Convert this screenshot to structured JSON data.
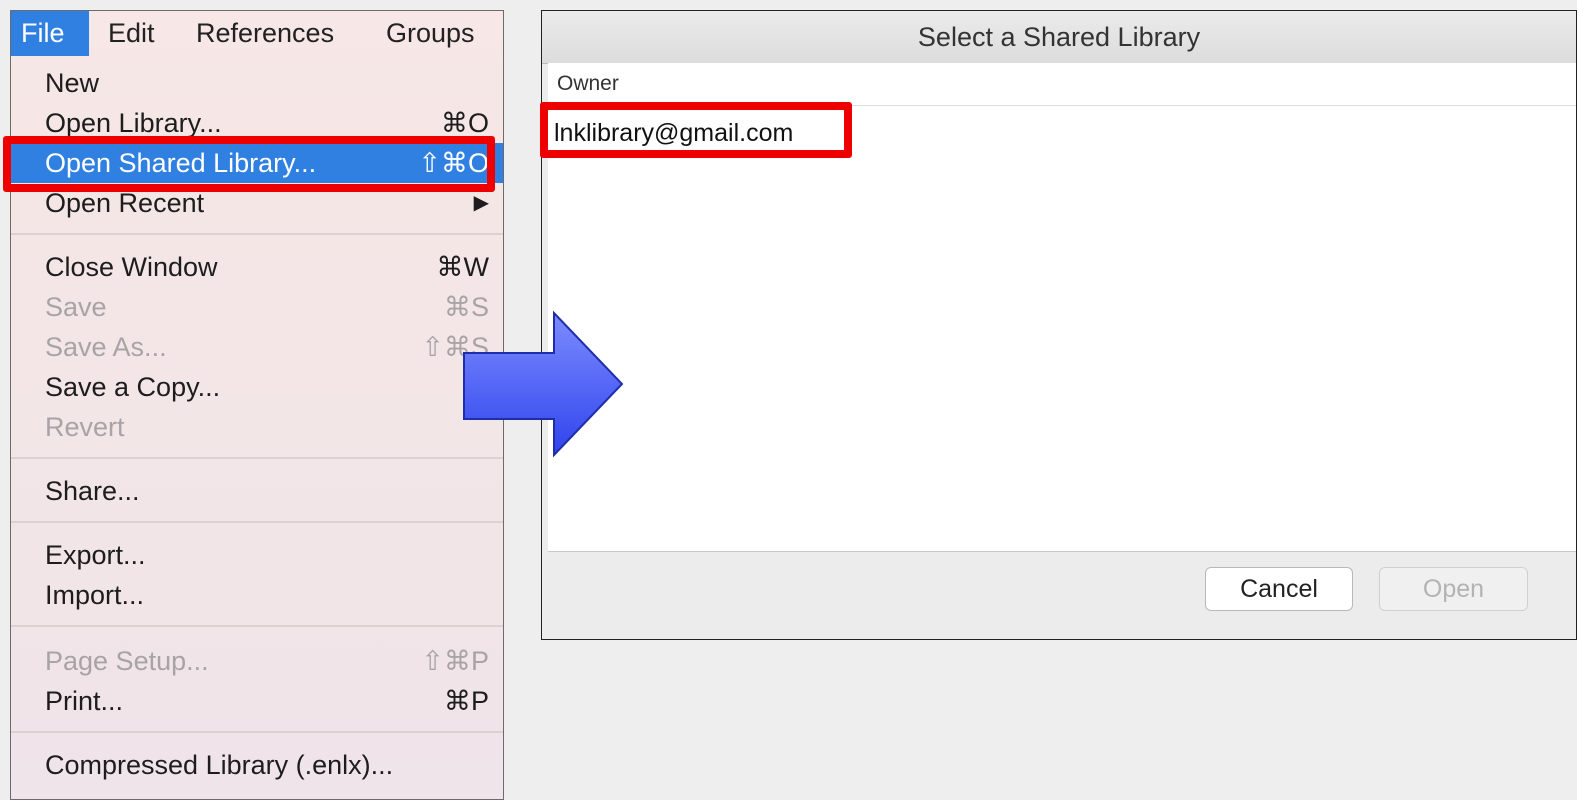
{
  "menubar": {
    "file": "File",
    "edit": "Edit",
    "references": "References",
    "groups": "Groups"
  },
  "file_menu": {
    "items": [
      {
        "label": "New",
        "shortcut": ""
      },
      {
        "label": "Open Library...",
        "shortcut": "⌘O"
      },
      {
        "label": "Open Shared Library...",
        "shortcut": "⇧⌘O"
      },
      {
        "label": "Open Recent",
        "shortcut": "▶"
      },
      {
        "label": "Close Window",
        "shortcut": "⌘W"
      },
      {
        "label": "Save",
        "shortcut": "⌘S"
      },
      {
        "label": "Save As...",
        "shortcut": "⇧⌘S"
      },
      {
        "label": "Save a Copy...",
        "shortcut": ""
      },
      {
        "label": "Revert",
        "shortcut": ""
      },
      {
        "label": "Share...",
        "shortcut": ""
      },
      {
        "label": "Export...",
        "shortcut": ""
      },
      {
        "label": "Import...",
        "shortcut": ""
      },
      {
        "label": "Page Setup...",
        "shortcut": "⇧⌘P"
      },
      {
        "label": "Print...",
        "shortcut": "⌘P"
      },
      {
        "label": "Compressed Library (.enlx)...",
        "shortcut": ""
      }
    ]
  },
  "dialog": {
    "title": "Select a Shared Library",
    "column_header": "Owner",
    "rows": [
      "lnklibrary@gmail.com"
    ],
    "cancel_label": "Cancel",
    "open_label": "Open"
  },
  "colors": {
    "highlight": "#2f80e0",
    "annotation_red": "#ee0000",
    "arrow_blue": "#4a5cf5"
  },
  "icons": {
    "arrow": "right-arrow-icon",
    "submenu": "chevron-right-icon"
  }
}
